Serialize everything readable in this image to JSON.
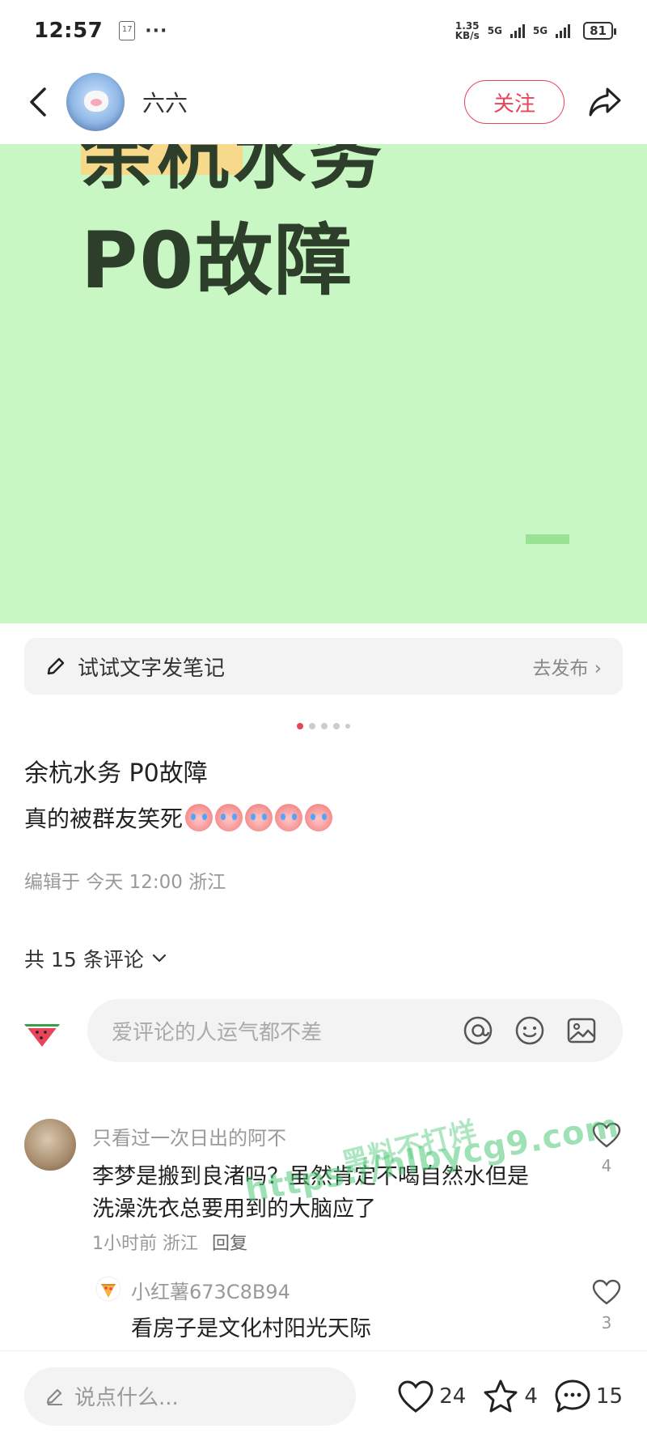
{
  "status_bar": {
    "time": "12:57",
    "calendar_day": "17",
    "more_dots": "···",
    "net_speed_value": "1.35",
    "net_speed_unit": "KB/s",
    "network_1": "5G",
    "network_2": "5G",
    "battery": "81"
  },
  "header": {
    "author_name": "六六",
    "follow_label": "关注"
  },
  "post_image": {
    "line1": "余杭水务",
    "line2": "P0故障",
    "background_color": "#c9f7c3"
  },
  "note_bar": {
    "label": "试试文字发笔记",
    "action": "去发布 ›"
  },
  "carousel": {
    "total": 5,
    "active_index": 0
  },
  "post": {
    "title": "余杭水务 P0故障",
    "body": "真的被群友笑死",
    "emoji_count": 5,
    "meta": "编辑于 今天 12:00 浙江"
  },
  "comments_section": {
    "count_label": "共 15 条评论",
    "composer_placeholder": "爱评论的人运气都不差"
  },
  "comments": [
    {
      "name": "只看过一次日出的阿不",
      "text": "李梦是搬到良渚吗？虽然肯定不喝自然水但是洗澡洗衣总要用到的大脑应了",
      "time": "1小时前",
      "location": "浙江",
      "reply_label": "回复",
      "likes": "4"
    },
    {
      "name": "小红薯673C8B94",
      "text": "看房子是文化村阳光天际",
      "likes": "3"
    }
  ],
  "watermark": {
    "text1": "黑料不打烊",
    "text2": "https://hlbycg9.com"
  },
  "bottom_bar": {
    "input_placeholder": "说点什么...",
    "like_count": "24",
    "star_count": "4",
    "comment_count": "15"
  },
  "colors": {
    "accent": "#e8445a",
    "image_bg": "#c9f7c3",
    "image_text": "#2d3e2b",
    "highlight": "#f6d98a"
  }
}
